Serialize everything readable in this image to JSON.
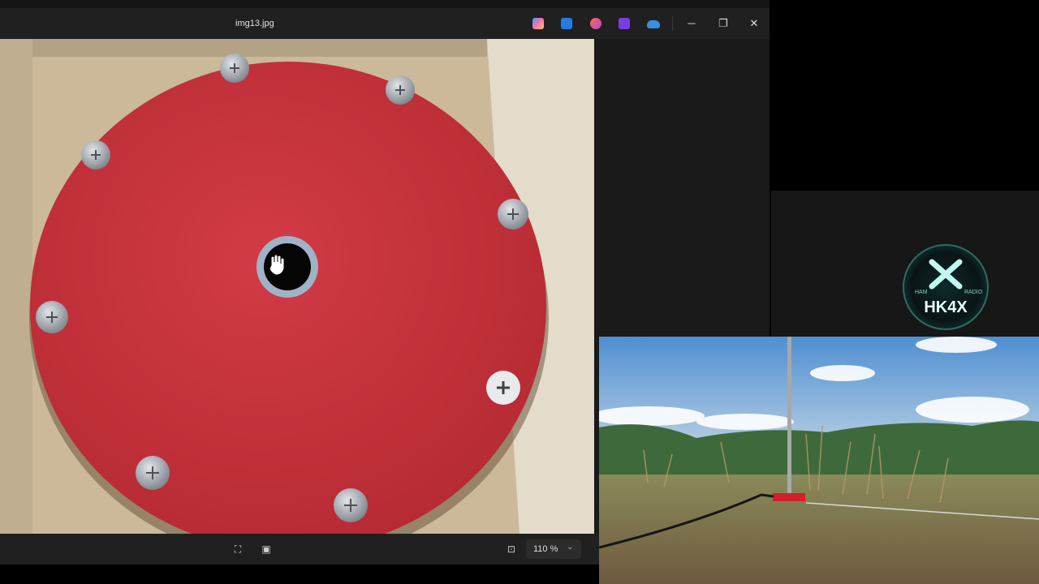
{
  "window": {
    "title": "img13.jpg",
    "app_icons": [
      "copilot-icon",
      "edit-icon",
      "designer-icon",
      "clipchamp-icon",
      "onedrive-icon"
    ],
    "controls": [
      "minimize-icon",
      "restore-icon",
      "close-icon"
    ]
  },
  "toolbar": {
    "zoom_value": "110 %"
  },
  "logo": {
    "text": "HK4X",
    "ring_left": "HAM",
    "ring_right": "RADIO"
  },
  "colors": {
    "disc": "#c8323b",
    "titlebar": "#202020",
    "logo_glow": "#7ff0e0"
  }
}
